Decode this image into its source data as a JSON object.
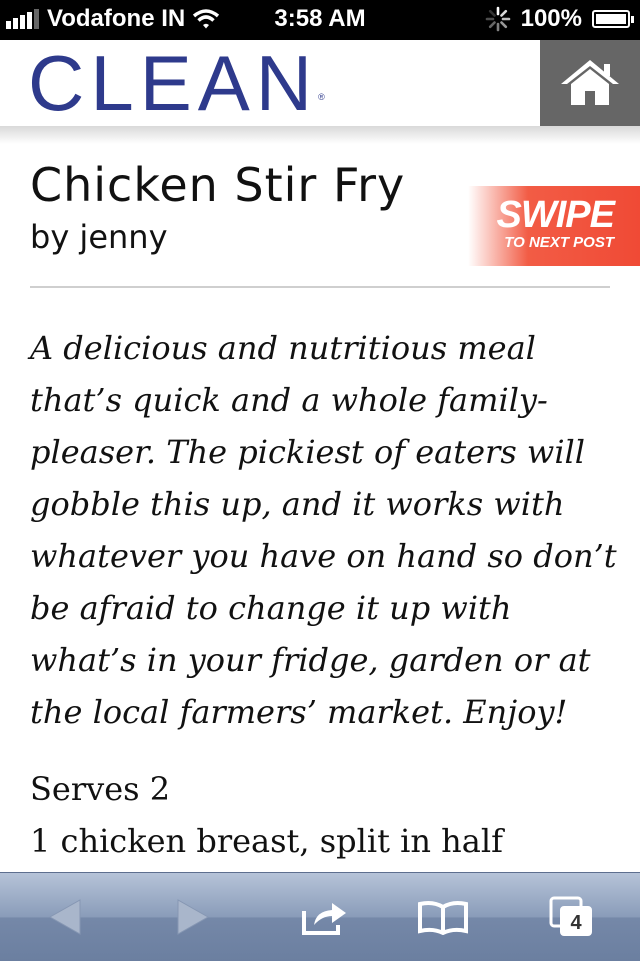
{
  "status_bar": {
    "carrier": "Vodafone IN",
    "time": "3:58 AM",
    "battery": "100%",
    "icons": [
      "signal-icon",
      "wifi-icon",
      "activity-spinner-icon",
      "battery-icon"
    ]
  },
  "site": {
    "logo": "CLEAN",
    "logo_mark": "®",
    "brand_color": "#2e3a8c",
    "home_icon": "home-icon"
  },
  "post": {
    "title": "Chicken Stir Fry",
    "byline": "by jenny",
    "swipe_main": "SWIPE",
    "swipe_sub": "TO NEXT POST",
    "swipe_color": "#f04a35",
    "intro": "A delicious and nutritious meal that’s quick and a whole family-pleaser. The pickiest of eaters will gobble this up, and it works with whatever you have on hand so don’t be afraid to change it up with what’s in your fridge, garden or at the local farmers’ market. Enjoy!",
    "serves": "Serves 2",
    "ingredient_1": "1 chicken breast, split in half"
  },
  "toolbar": {
    "items": [
      "back-arrow-icon",
      "forward-arrow-icon",
      "share-icon",
      "bookmarks-icon",
      "tabs-icon"
    ],
    "tabs_count": "4"
  }
}
